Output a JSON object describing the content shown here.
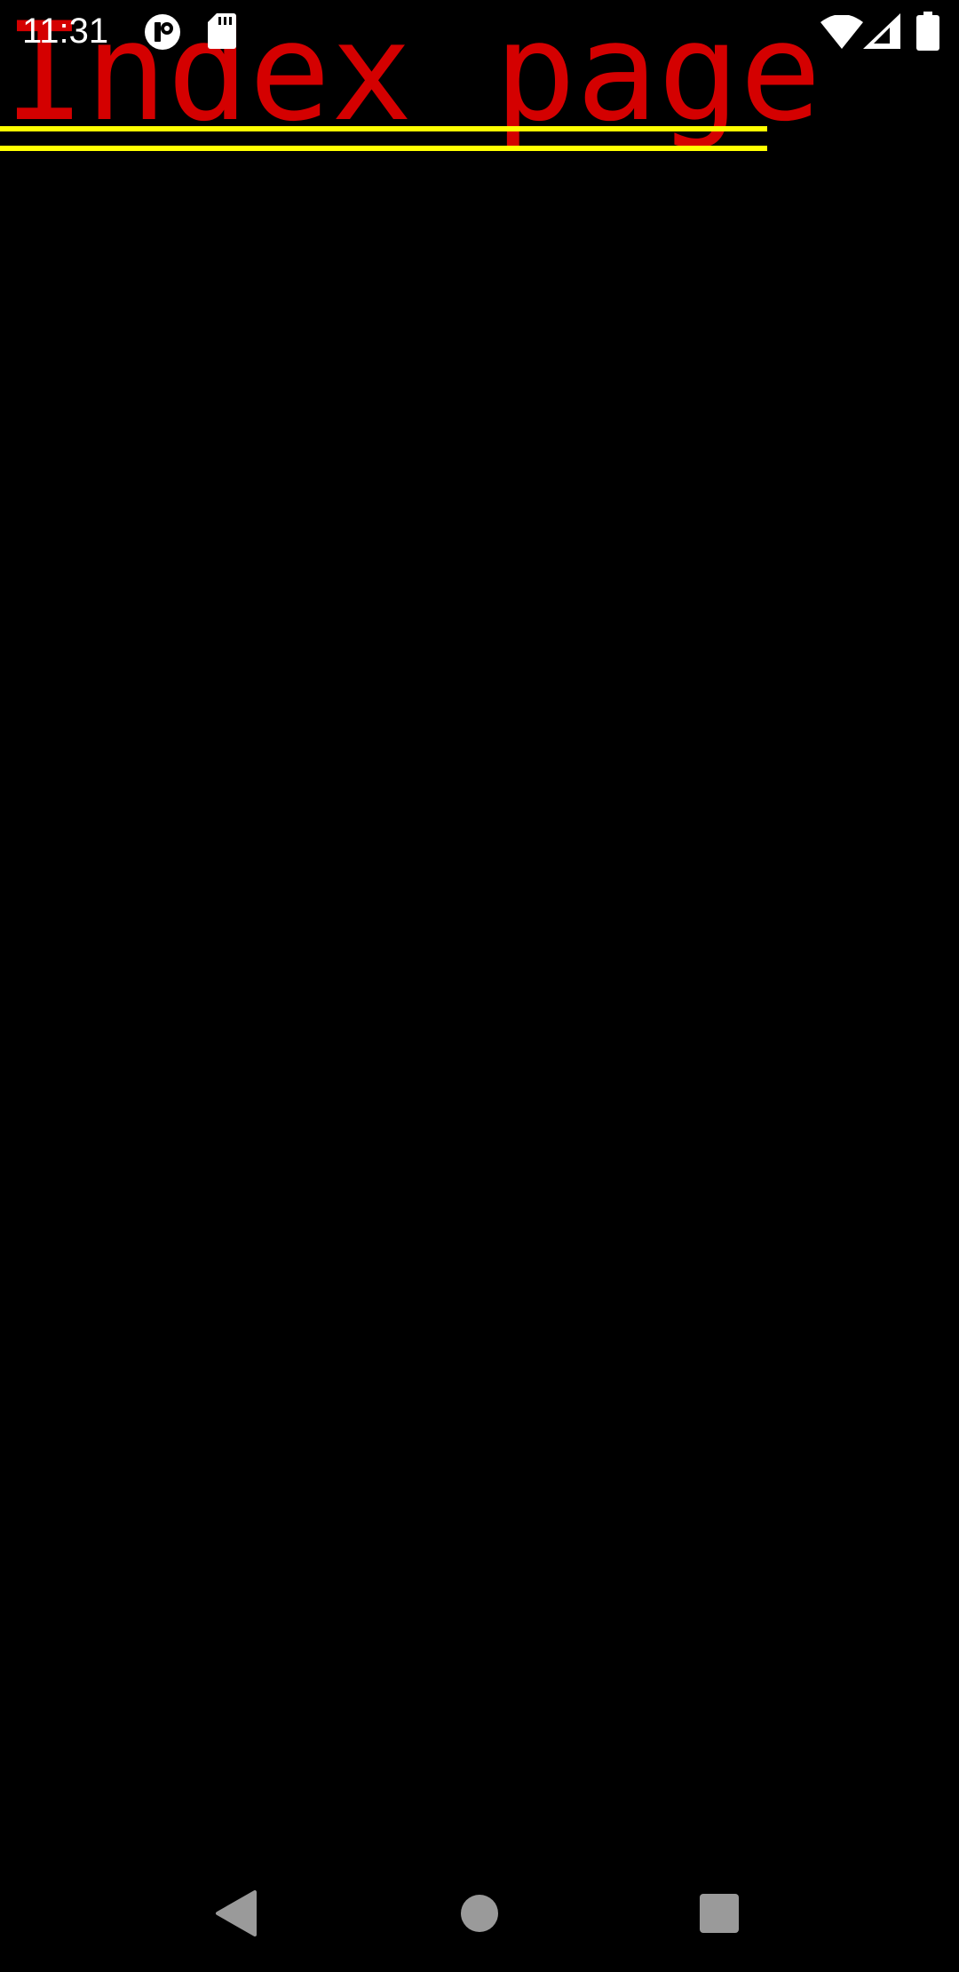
{
  "status_bar": {
    "time": "11:31",
    "icons": [
      "notification-ring-icon",
      "sd-card-icon",
      "wifi-icon",
      "cell-signal-icon",
      "battery-icon"
    ]
  },
  "page": {
    "heading": "Index page"
  },
  "nav_bar": {
    "buttons": [
      "back-icon",
      "home-icon",
      "recents-icon"
    ]
  },
  "colors": {
    "background": "#000000",
    "heading": "#d40000",
    "rules": "#ffff00",
    "status_icons": "#ffffff",
    "nav_icons": "#9a9a9a"
  }
}
